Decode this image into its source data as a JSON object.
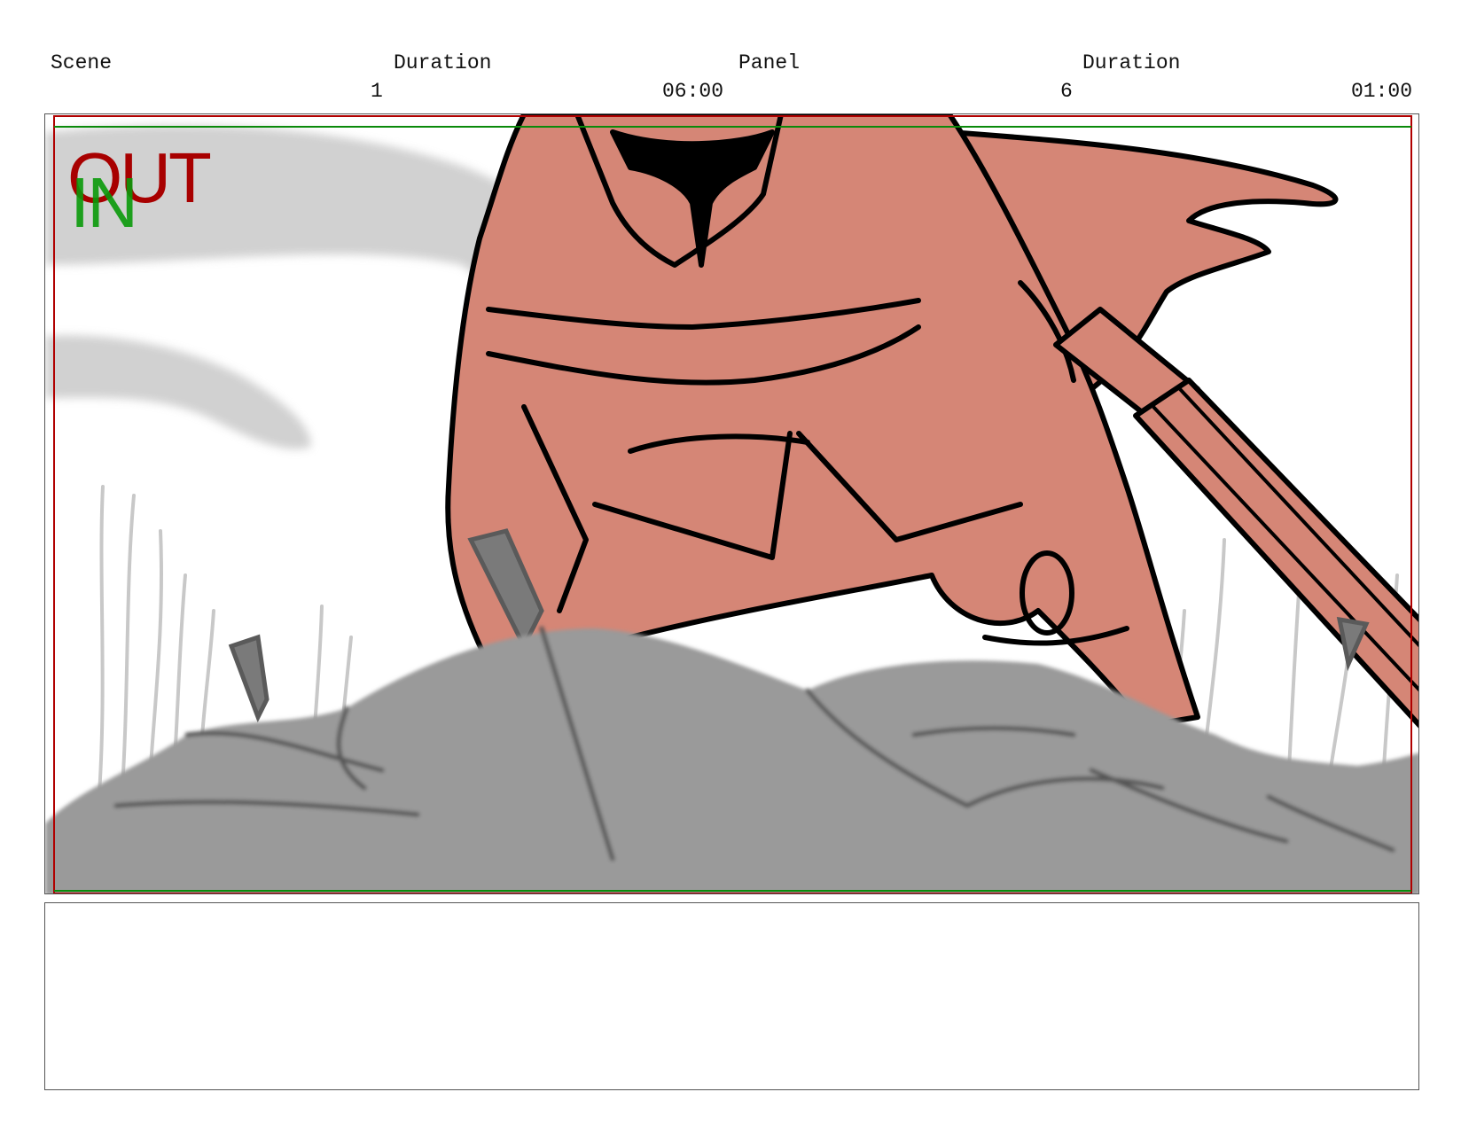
{
  "header": {
    "scene_label": "Scene",
    "scene_duration_label": "Duration",
    "panel_label": "Panel",
    "panel_duration_label": "Duration",
    "scene_number": "1",
    "scene_duration": "06:00",
    "panel_number": "6",
    "panel_duration": "01:00"
  },
  "panel": {
    "out_marker": "OUT",
    "in_marker": "IN",
    "out_color": "#a80000",
    "in_color": "#0a9a0a",
    "character_fill": "#d58676",
    "rock_fill": "#9a9a9a",
    "smoke_fill": "#cfcfcf"
  },
  "notes": {
    "text": ""
  }
}
